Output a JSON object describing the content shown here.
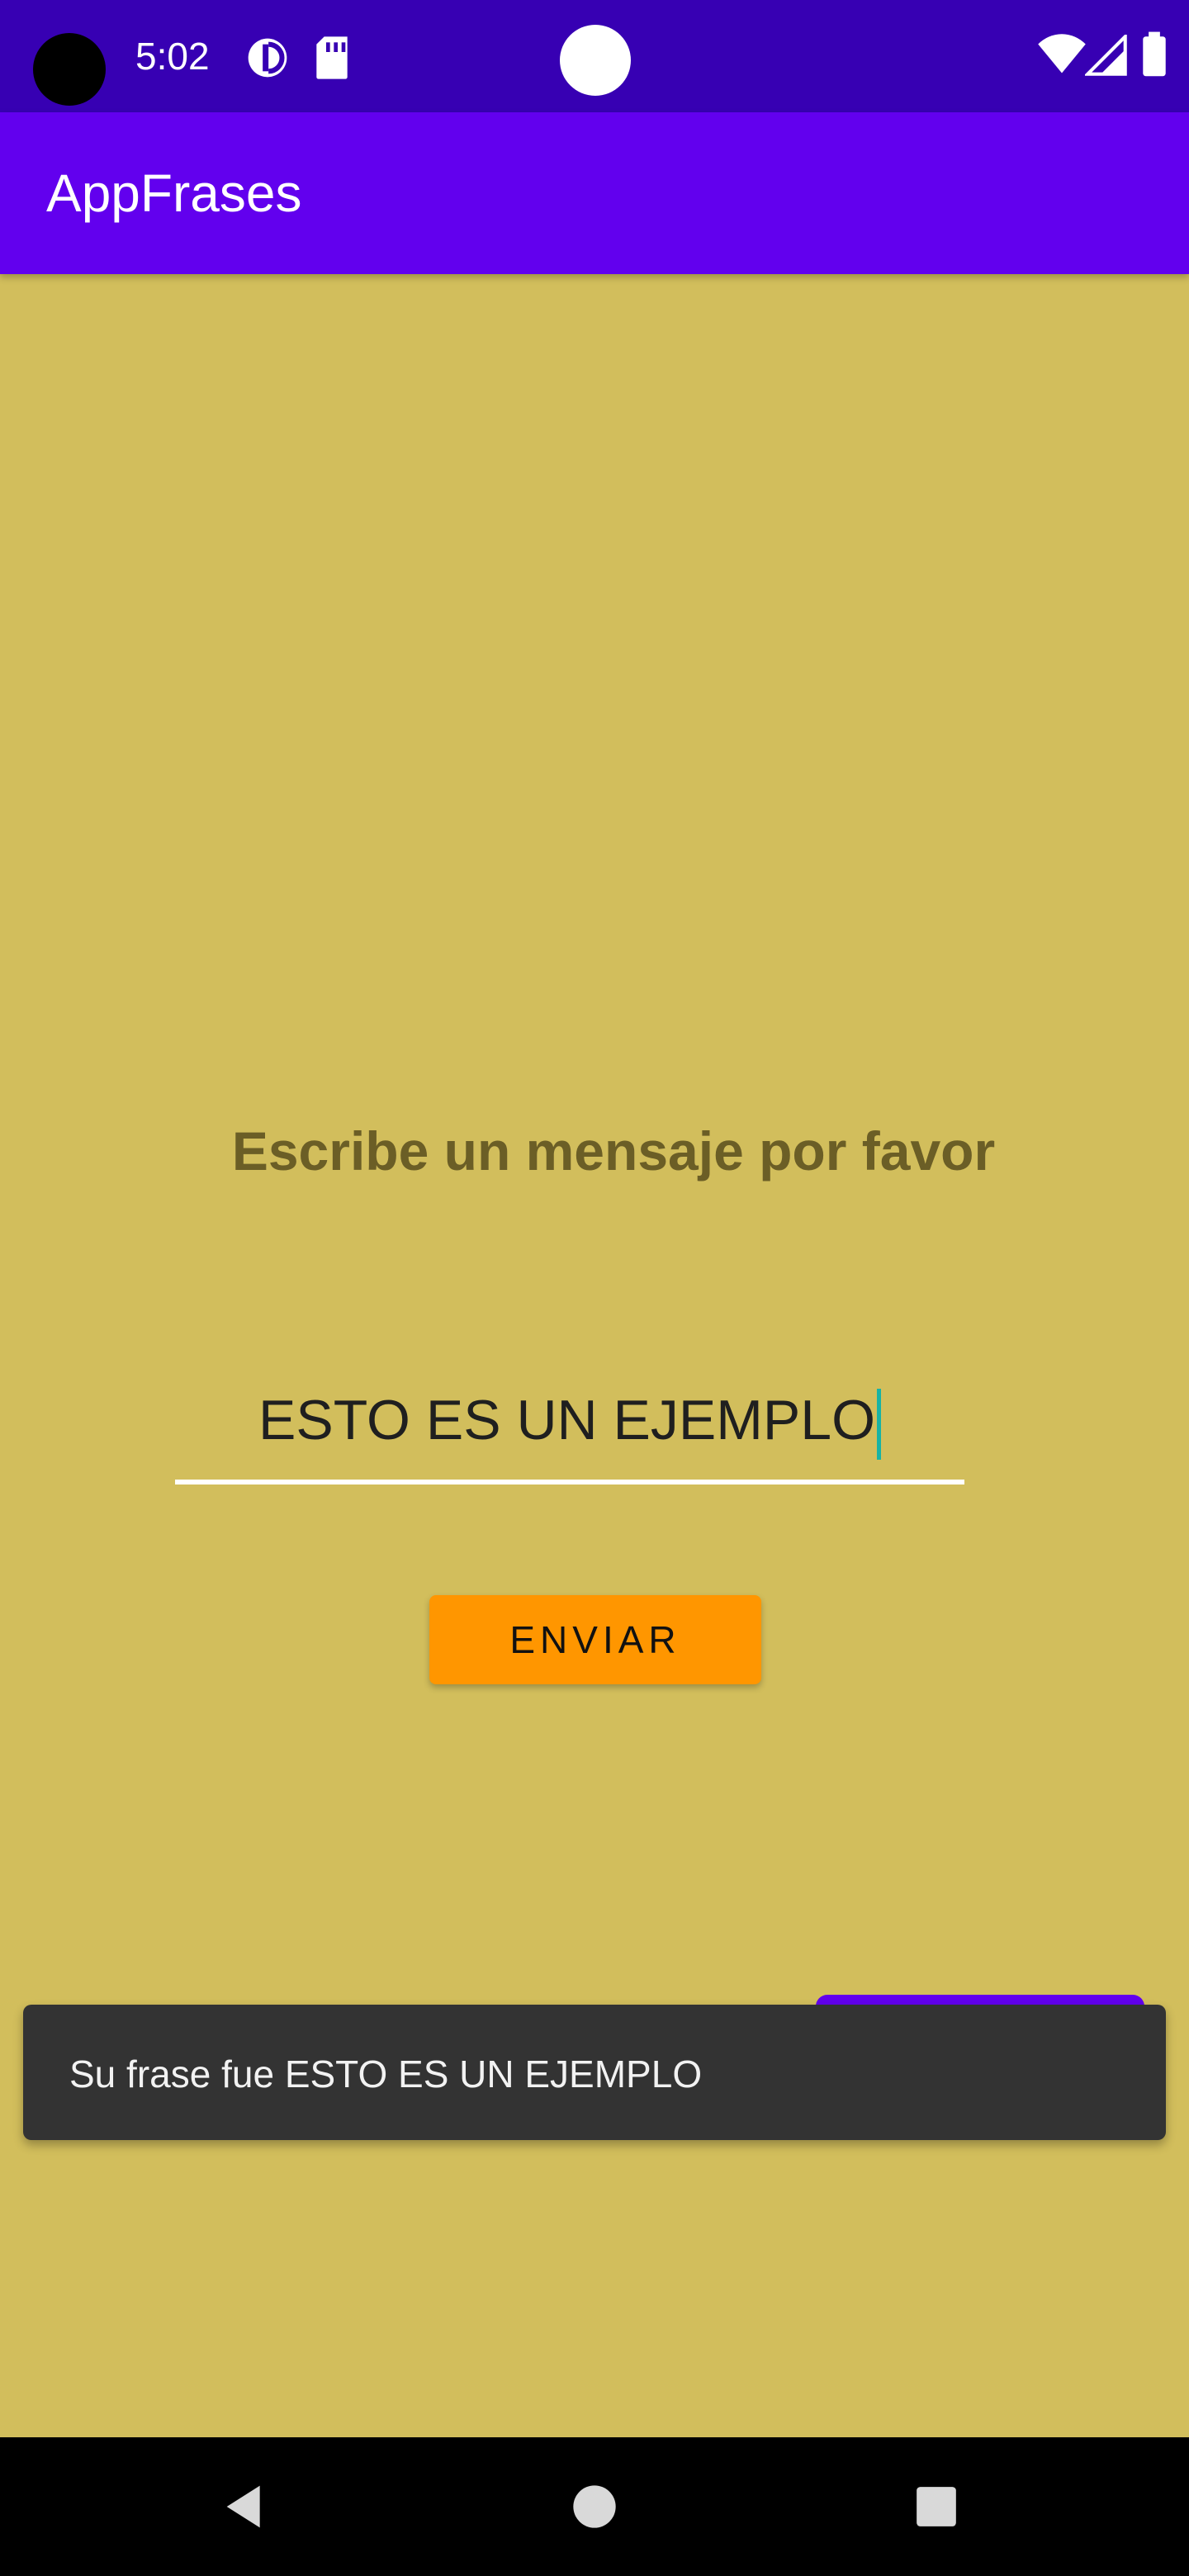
{
  "status_bar": {
    "time": "5:02",
    "icons": [
      "camera-cutout",
      "data-saver-icon",
      "sd-card-icon",
      "wifi-icon",
      "signal-icon",
      "battery-icon"
    ]
  },
  "app_bar": {
    "title": "AppFrases"
  },
  "main": {
    "prompt": "Escribe un mensaje por favor",
    "input_value": "ESTO ES UN EJEMPLO",
    "send_label": "ENVIAR"
  },
  "snackbar": {
    "message": "Su frase fue ESTO ES UN EJEMPLO"
  },
  "nav_bar": {
    "buttons": [
      "back-icon",
      "home-icon",
      "recents-icon"
    ]
  },
  "colors": {
    "status_bar": "#3700b3",
    "app_bar": "#6200ee",
    "background": "#d2be5c",
    "button": "#ff9600",
    "snackbar": "#333333"
  }
}
